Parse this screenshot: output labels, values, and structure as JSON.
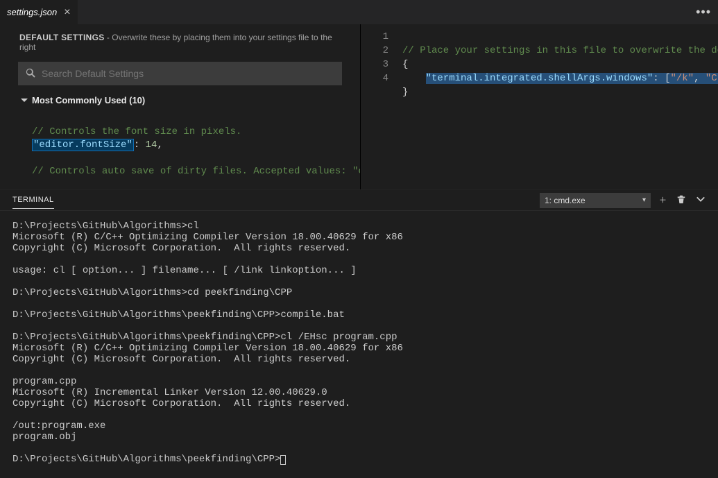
{
  "tab": {
    "title": "settings.json"
  },
  "defaults": {
    "heading": "DEFAULT SETTINGS",
    "subtitle": " - Overwrite these by placing them into your settings file to the right",
    "search_placeholder": "Search Default Settings",
    "section_label": "Most Commonly Used (10)",
    "comment1": "// Controls the font size in pixels.",
    "key1": "\"editor.fontSize\"",
    "val1": "14",
    "comment2": "// Controls auto save of dirty files. Accepted values: \"off\", \"afterDelay\", \"onFocusChange\" (editor loses focus)"
  },
  "editor": {
    "line_numbers": [
      "1",
      "2",
      "3",
      "4"
    ],
    "line1": "// Place your settings in this file to overwrite the defau",
    "line2": "{",
    "line3_key": "\"terminal.integrated.shellArgs.windows\"",
    "line3_after": ": [",
    "line3_str1": "\"/k\"",
    "line3_comma": ", ",
    "line3_str2": "\"C:\\\\P",
    "line4": "}"
  },
  "terminal": {
    "panel_title": "TERMINAL",
    "selector": "1: cmd.exe",
    "content": "D:\\Projects\\GitHub\\Algorithms>cl\nMicrosoft (R) C/C++ Optimizing Compiler Version 18.00.40629 for x86\nCopyright (C) Microsoft Corporation.  All rights reserved.\n\nusage: cl [ option... ] filename... [ /link linkoption... ]\n\nD:\\Projects\\GitHub\\Algorithms>cd peekfinding\\CPP\n\nD:\\Projects\\GitHub\\Algorithms\\peekfinding\\CPP>compile.bat\n\nD:\\Projects\\GitHub\\Algorithms\\peekfinding\\CPP>cl /EHsc program.cpp\nMicrosoft (R) C/C++ Optimizing Compiler Version 18.00.40629 for x86\nCopyright (C) Microsoft Corporation.  All rights reserved.\n\nprogram.cpp\nMicrosoft (R) Incremental Linker Version 12.00.40629.0\nCopyright (C) Microsoft Corporation.  All rights reserved.\n\n/out:program.exe\nprogram.obj\n\nD:\\Projects\\GitHub\\Algorithms\\peekfinding\\CPP>"
  }
}
